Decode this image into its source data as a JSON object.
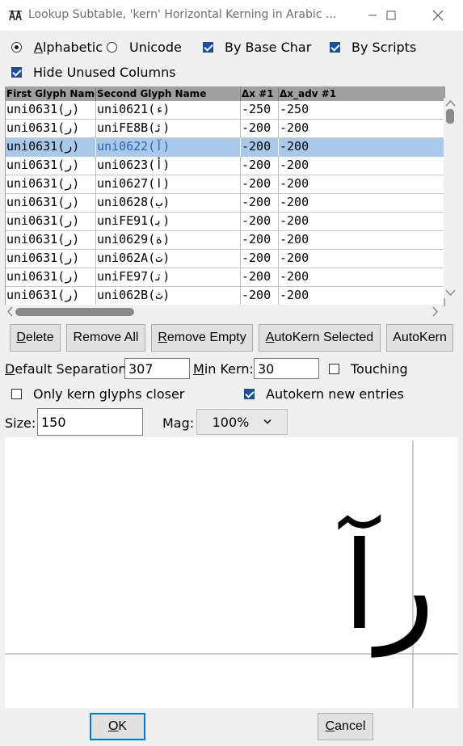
{
  "window": {
    "title": "Lookup Subtable, 'kern' Horizontal Kerning in Arabic ..."
  },
  "sort": {
    "alphabetic_label": "Alphabetic",
    "unicode_label": "Unicode",
    "selected": "alphabetic",
    "by_base_char_label": "By Base Char",
    "by_base_char_checked": true,
    "by_scripts_label": "By Scripts",
    "by_scripts_checked": true,
    "hide_unused_label": "Hide Unused Columns",
    "hide_unused_checked": true
  },
  "table": {
    "columns": [
      "First Glyph Name",
      "Second Glyph Name",
      "Δx #1",
      "Δx_adv #1"
    ],
    "rows": [
      {
        "first": "uni0631(ر)",
        "second": "uni0621(ء)",
        "dx": "-250",
        "dx_adv": "-250"
      },
      {
        "first": "uni0631(ر)",
        "second": "uniFE8B(ﺋ)",
        "dx": "-200",
        "dx_adv": "-200"
      },
      {
        "first": "uni0631(ر)",
        "second": "uni0622(آ)",
        "dx": "-200",
        "dx_adv": "-200"
      },
      {
        "first": "uni0631(ر)",
        "second": "uni0623(أ)",
        "dx": "-200",
        "dx_adv": "-200"
      },
      {
        "first": "uni0631(ر)",
        "second": "uni0627(ا)",
        "dx": "-200",
        "dx_adv": "-200"
      },
      {
        "first": "uni0631(ر)",
        "second": "uni0628(ب)",
        "dx": "-200",
        "dx_adv": "-200"
      },
      {
        "first": "uni0631(ر)",
        "second": "uniFE91(ﺑ)",
        "dx": "-200",
        "dx_adv": "-200"
      },
      {
        "first": "uni0631(ر)",
        "second": "uni0629(ة)",
        "dx": "-200",
        "dx_adv": "-200"
      },
      {
        "first": "uni0631(ر)",
        "second": "uni062A(ت)",
        "dx": "-200",
        "dx_adv": "-200"
      },
      {
        "first": "uni0631(ر)",
        "second": "uniFE97(ﺗ)",
        "dx": "-200",
        "dx_adv": "-200"
      },
      {
        "first": "uni0631(ر)",
        "second": "uni062B(ث)",
        "dx": "-200",
        "dx_adv": "-200"
      }
    ],
    "selected_row": 2
  },
  "buttons": {
    "delete": "Delete",
    "remove_all": "Remove All",
    "remove_empty": "Remove Empty",
    "autokern_selected": "AutoKern Selected",
    "autokern": "AutoKern"
  },
  "settings": {
    "default_separation_label": "Default Separation:",
    "default_separation_value": "307",
    "min_kern_label": "Min Kern:",
    "min_kern_value": "30",
    "touching_label": "Touching",
    "touching_checked": false,
    "only_closer_label": "Only kern glyphs closer",
    "only_closer_checked": false,
    "autokern_new_label": "Autokern new entries",
    "autokern_new_checked": true,
    "size_label": "Size:",
    "size_value": "150",
    "mag_label": "Mag:",
    "mag_value": "100%"
  },
  "preview": {
    "glyphs": "رآ"
  },
  "footer": {
    "ok": "OK",
    "cancel": "Cancel"
  },
  "colors": {
    "selection": "#a8c9ea",
    "checkbox": "#1b4f9c",
    "header": "#a0a0a0"
  }
}
